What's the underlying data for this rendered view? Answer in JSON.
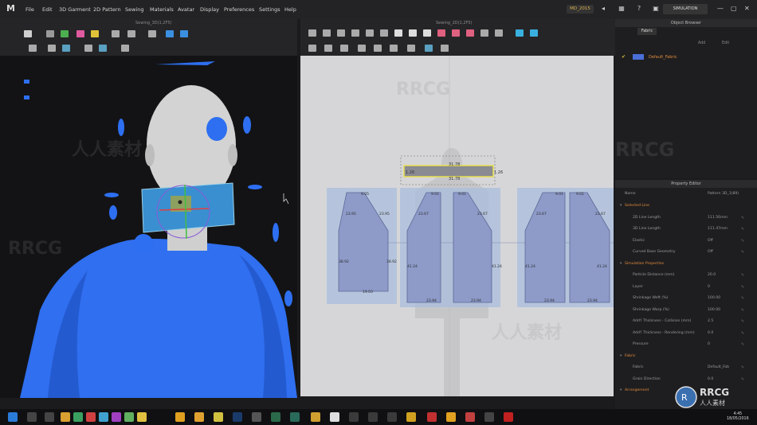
{
  "app": {
    "logo_text": "M",
    "menu": [
      "File",
      "Edit",
      "3D Garment",
      "2D Pattern",
      "Sewing",
      "Materials",
      "Avatar",
      "Display",
      "Preferences",
      "Settings",
      "Help"
    ],
    "workspace_badge": "MD_2015",
    "simulation_label": "SIMULATION"
  },
  "viewport3d": {
    "title": "Sewing_3D(1,2F5)"
  },
  "viewport2d": {
    "title": "Sewing_2D(1,2F5)",
    "collar_labels": {
      "top": "31.78",
      "left": "1.26",
      "right": "1.26",
      "bottom": "31.78"
    },
    "piece_labels": {
      "p1": [
        "9.05",
        "23.95",
        "23.95",
        "38.92",
        "38.92",
        "19.03"
      ],
      "p2": [
        "9.01",
        "23.67",
        "41.24",
        "23.94"
      ],
      "p3": [
        "9.01",
        "23.67",
        "41.24",
        "23.94"
      ],
      "p4": [
        "9.01",
        "23.67",
        "41.24",
        "23.94"
      ],
      "p5": [
        "9.01",
        "23.67",
        "41.24",
        "23.94"
      ]
    }
  },
  "browser": {
    "title": "Object Browser",
    "tab": "Fabric",
    "buttons": [
      "Add",
      "Edit"
    ],
    "fabric_name": "Default_Fabric",
    "fabric_color": "#4a6fd8"
  },
  "property_editor": {
    "title": "Property Editor",
    "header": {
      "label": "Name",
      "value": "Pattern 3D_1(89)"
    },
    "rows": [
      {
        "type": "section",
        "label": "Selected Line"
      },
      {
        "type": "row",
        "label": "2D Line Length",
        "value": "111.56mm"
      },
      {
        "type": "row",
        "label": "3D Line Length",
        "value": "111.47mm"
      },
      {
        "type": "row",
        "label": "Elastic",
        "value": "Off"
      },
      {
        "type": "row",
        "label": "Curved Base Geometry",
        "value": "Off"
      },
      {
        "type": "section",
        "label": "Simulation Properties"
      },
      {
        "type": "row",
        "label": "Particle Distance (mm)",
        "value": "20.0"
      },
      {
        "type": "row",
        "label": "Layer",
        "value": "0"
      },
      {
        "type": "row",
        "label": "Shrinkage Weft (%)",
        "value": "100.00"
      },
      {
        "type": "row",
        "label": "Shrinkage Warp (%)",
        "value": "100.00"
      },
      {
        "type": "row",
        "label": "Add'l Thickness - Collision (mm)",
        "value": "2.5"
      },
      {
        "type": "row",
        "label": "Add'l Thickness - Rendering (mm)",
        "value": "0.0"
      },
      {
        "type": "row",
        "label": "Pressure",
        "value": "0"
      },
      {
        "type": "section",
        "label": "Fabric"
      },
      {
        "type": "row",
        "label": "Fabric",
        "value": "Default_Fab"
      },
      {
        "type": "row",
        "label": "Grain Direction",
        "value": "0.0"
      },
      {
        "type": "section",
        "label": "Arrangement"
      }
    ]
  },
  "taskbar": {
    "time": "4:45",
    "date": "18/05/2016"
  },
  "watermark": {
    "logo": "RRCG",
    "text": "人人素材"
  },
  "colors": {
    "avatar_blue": "#2d6ff0",
    "collar": "#3a8fd0",
    "pattern_fill": "#8e9bc9",
    "section_orange": "#e08a3a"
  }
}
